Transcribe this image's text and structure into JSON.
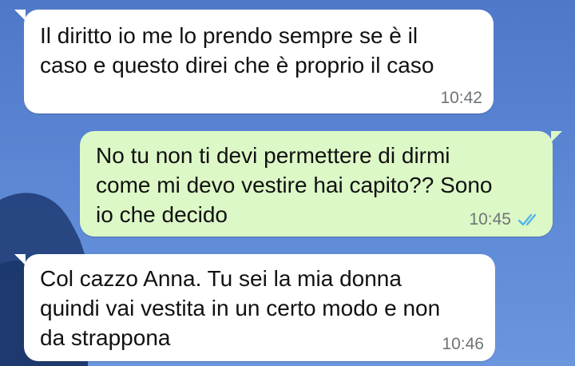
{
  "messages": [
    {
      "direction": "incoming",
      "text": "Il diritto io me lo prendo sempre se è il\ncaso e questo direi che è proprio il caso",
      "time": "10:42"
    },
    {
      "direction": "outgoing",
      "text": "No tu non ti devi permettere di dirmi\ncome mi devo vestire hai capito?? Sono\nio che decido",
      "time": "10:45",
      "status_icon": "double-check-read-icon"
    },
    {
      "direction": "incoming",
      "text": "Col cazzo Anna. Tu sei la mia donna\nquindi vai vestita in un certo modo e non\nda strappona",
      "time": "10:46"
    }
  ],
  "colors": {
    "background_blue": "#5a86d4",
    "incoming_bubble": "#ffffff",
    "outgoing_bubble": "#dcf8c6",
    "read_ticks": "#4fb6ec",
    "timestamp": "#6f7377"
  }
}
